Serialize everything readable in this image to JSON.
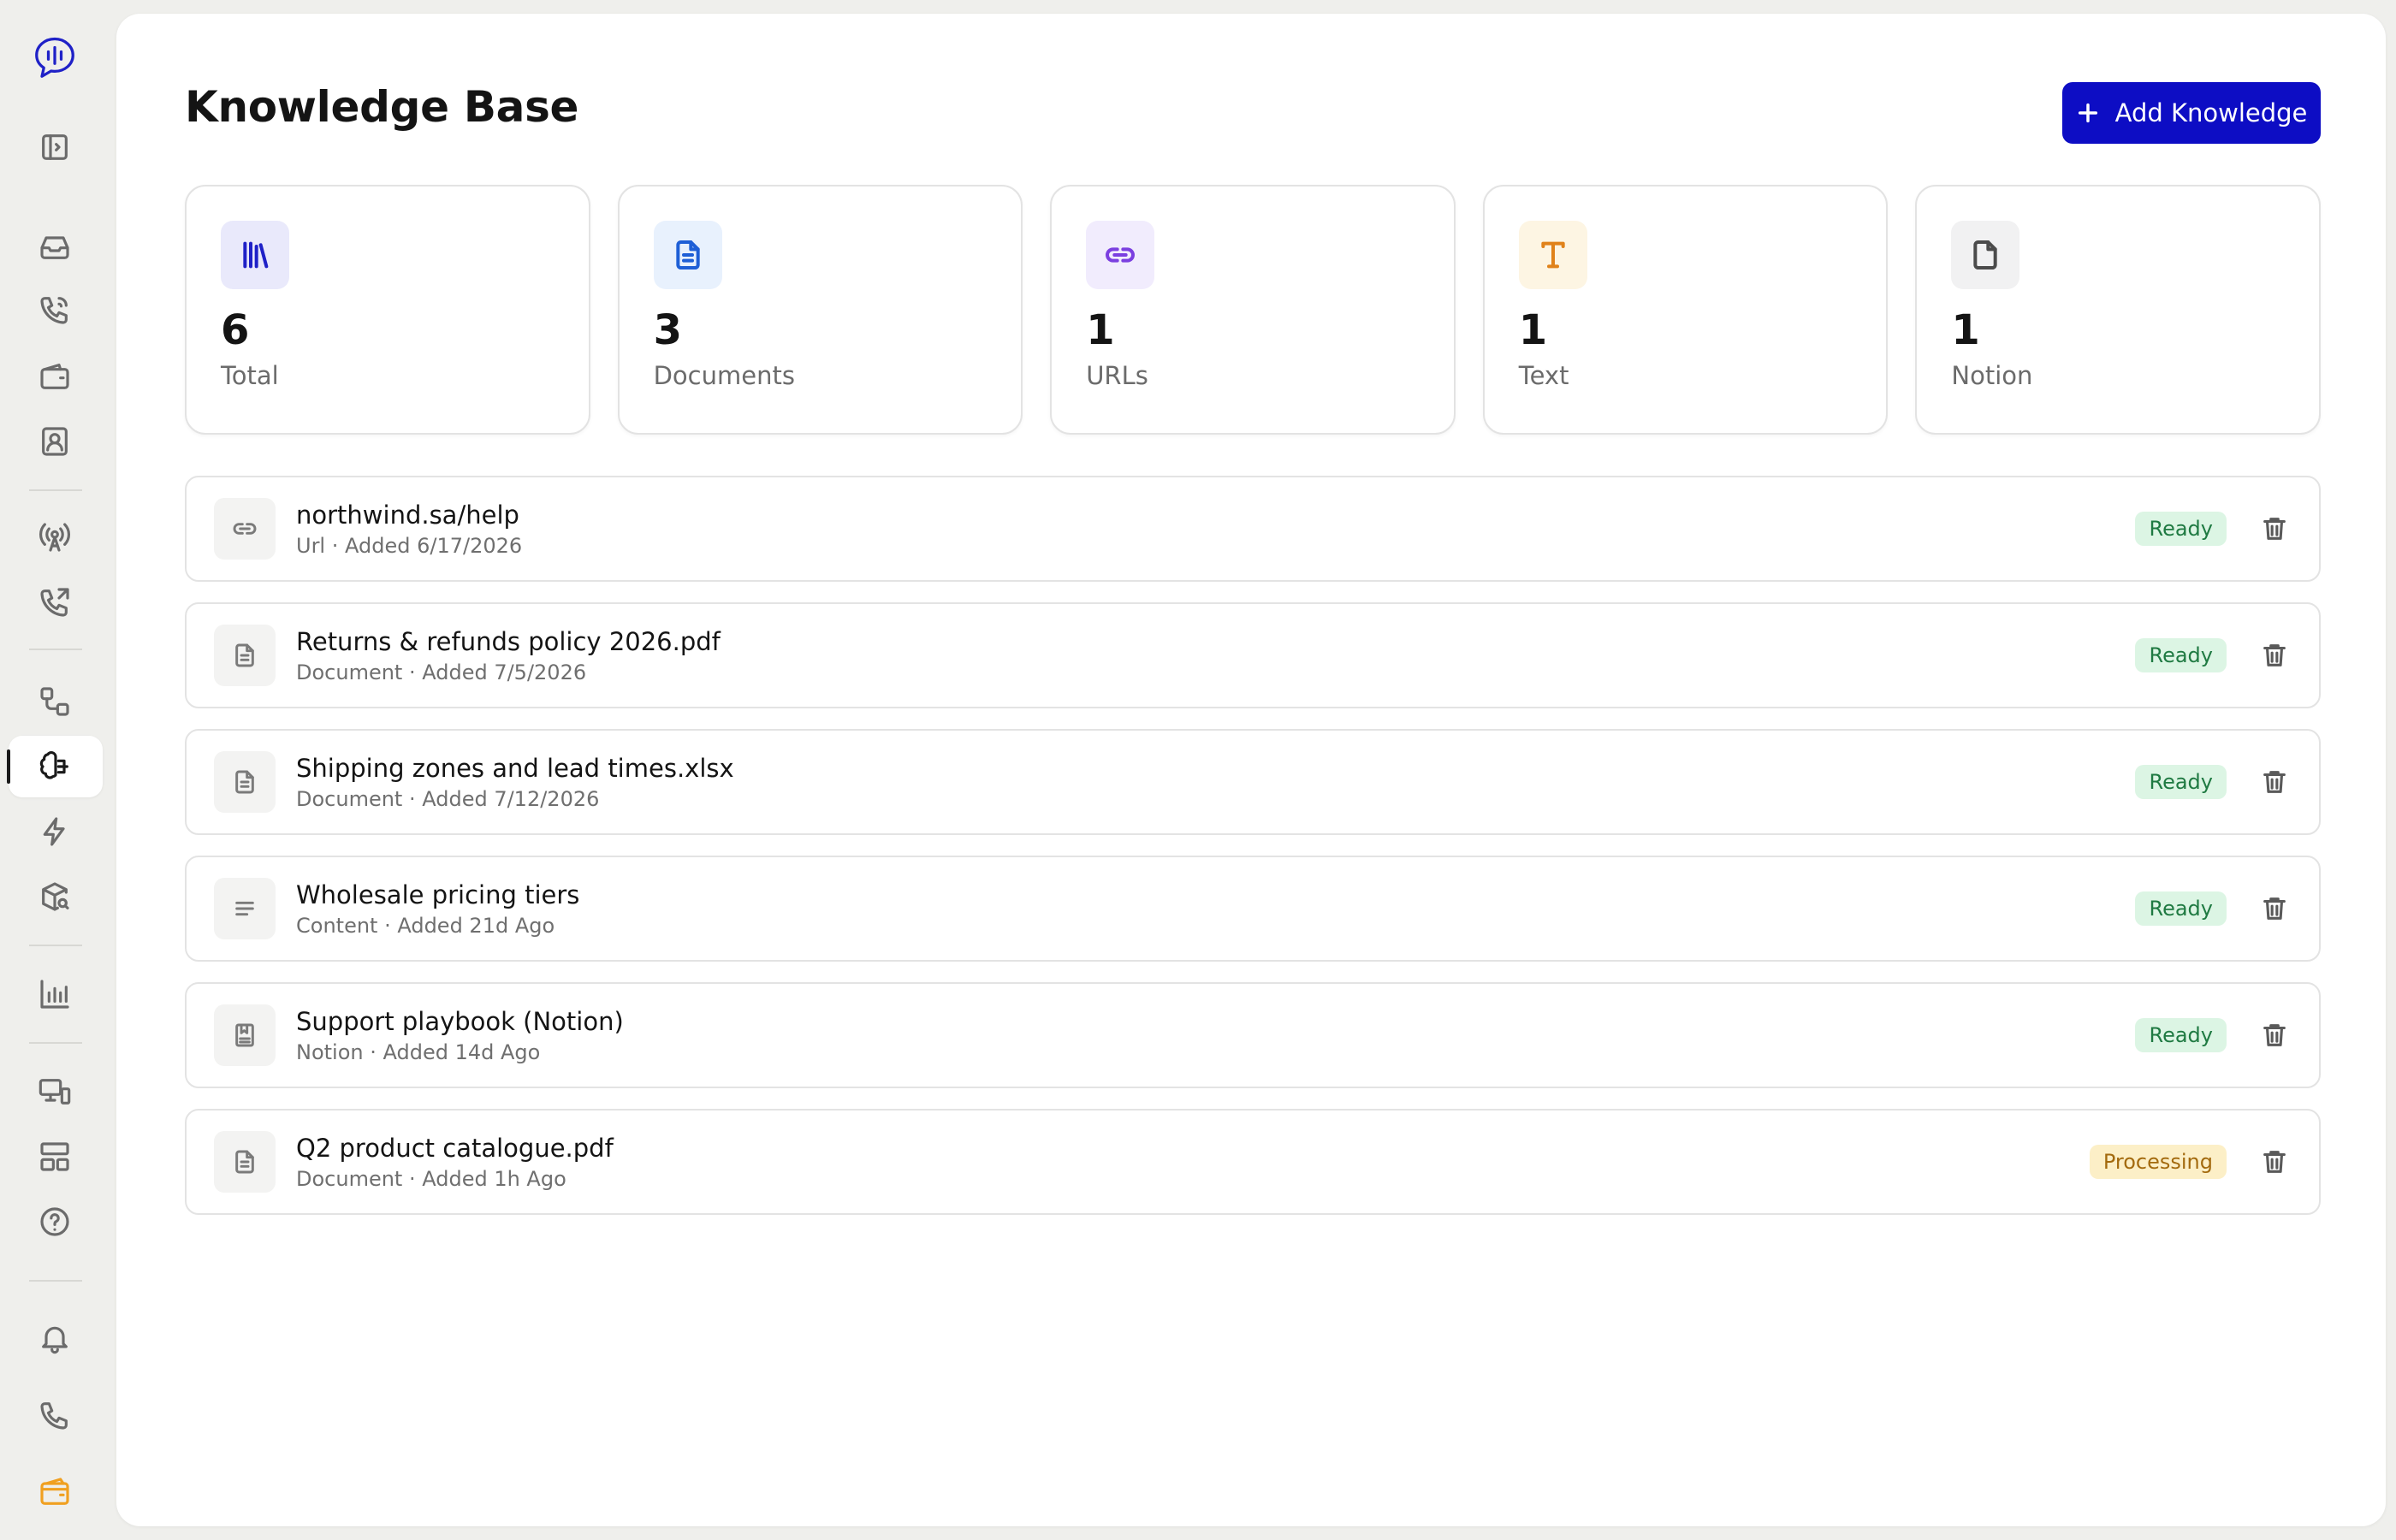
{
  "sidebar": {
    "items": [
      {
        "icon": "logo-icon"
      },
      {
        "icon": "sidebar-toggle-icon"
      },
      {
        "icon": "inbox-icon"
      },
      {
        "icon": "phone-call-icon"
      },
      {
        "icon": "wallet-icon"
      },
      {
        "icon": "contact-icon"
      },
      {
        "icon": "broadcast-icon"
      },
      {
        "icon": "outgoing-call-icon"
      },
      {
        "icon": "workflow-icon"
      },
      {
        "icon": "knowledge-brain-icon",
        "active": true
      },
      {
        "icon": "lightning-icon"
      },
      {
        "icon": "package-search-icon"
      },
      {
        "icon": "bar-chart-icon"
      },
      {
        "icon": "devices-icon"
      },
      {
        "icon": "layout-icon"
      },
      {
        "icon": "help-icon"
      },
      {
        "icon": "bell-icon"
      },
      {
        "icon": "phone-icon"
      },
      {
        "icon": "wallet-icon",
        "color": "#f0a020"
      }
    ]
  },
  "header": {
    "title": "Knowledge Base",
    "add_button_label": "Add Knowledge"
  },
  "stats": [
    {
      "value": "6",
      "label": "Total",
      "icon": "library-icon",
      "bg": "#e9e9fb",
      "color": "#1f21c7"
    },
    {
      "value": "3",
      "label": "Documents",
      "icon": "document-icon",
      "bg": "#e8f1fd",
      "color": "#1e5fd6"
    },
    {
      "value": "1",
      "label": "URLs",
      "icon": "link-icon",
      "bg": "#f1ecfd",
      "color": "#7b3fe0"
    },
    {
      "value": "1",
      "label": "Text",
      "icon": "text-icon",
      "bg": "#fdf5e3",
      "color": "#e0821a"
    },
    {
      "value": "1",
      "label": "Notion",
      "icon": "file-icon",
      "bg": "#f1f1f2",
      "color": "#4b4b4b"
    }
  ],
  "items": [
    {
      "title": "northwind.sa/help",
      "meta": "Url · Added 6/17/2026",
      "status": "Ready",
      "icon": "link-icon"
    },
    {
      "title": "Returns & refunds policy 2026.pdf",
      "meta": "Document · Added 7/5/2026",
      "status": "Ready",
      "icon": "document-icon"
    },
    {
      "title": "Shipping zones and lead times.xlsx",
      "meta": "Document · Added 7/12/2026",
      "status": "Ready",
      "icon": "document-icon"
    },
    {
      "title": "Wholesale pricing tiers",
      "meta": "Content · Added 21d Ago",
      "status": "Ready",
      "icon": "text-lines-icon"
    },
    {
      "title": "Support playbook (Notion)",
      "meta": "Notion · Added 14d Ago",
      "status": "Ready",
      "icon": "notion-icon"
    },
    {
      "title": "Q2 product catalogue.pdf",
      "meta": "Document · Added 1h Ago",
      "status": "Processing",
      "icon": "document-icon"
    }
  ],
  "colors": {
    "accent": "#0d0dc4",
    "ready_bg": "#dcf5e4",
    "ready_text": "#1f7a42",
    "processing_bg": "#fcefc7",
    "processing_text": "#a36a0e"
  }
}
